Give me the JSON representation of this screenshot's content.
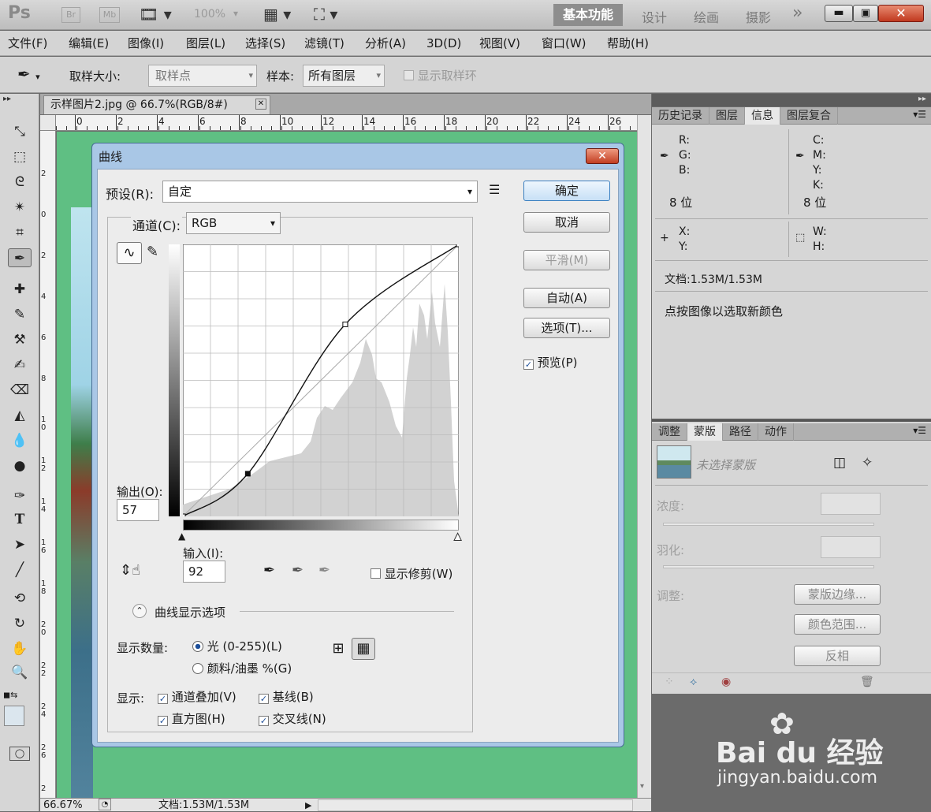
{
  "appbar": {
    "logo": "Ps",
    "br": "Br",
    "mb": "Mb",
    "zoom": "100%",
    "workspaces": [
      "基本功能",
      "设计",
      "绘画",
      "摄影"
    ],
    "more": "»"
  },
  "menubar": [
    "文件(F)",
    "编辑(E)",
    "图像(I)",
    "图层(L)",
    "选择(S)",
    "滤镜(T)",
    "分析(A)",
    "3D(D)",
    "视图(V)",
    "窗口(W)",
    "帮助(H)"
  ],
  "options": {
    "sample_size_label": "取样大小:",
    "sample_size_value": "取样点",
    "sample_label": "样本:",
    "sample_value": "所有图层",
    "show_ring": "显示取样环"
  },
  "document": {
    "tab_title": "示样图片2.jpg @ 66.7%(RGB/8#)",
    "zoom": "66.67%",
    "status": "文档:1.53M/1.53M",
    "ruler_h": [
      "0",
      "2",
      "4",
      "6",
      "8",
      "10",
      "12",
      "14",
      "16",
      "18",
      "20",
      "22",
      "24",
      "26"
    ],
    "ruler_v": [
      "2",
      "0",
      "2",
      "4",
      "6",
      "8",
      "10",
      "12",
      "14",
      "16",
      "18",
      "20",
      "22",
      "24",
      "26",
      "2"
    ]
  },
  "curves": {
    "title": "曲线",
    "preset_label": "预设(R):",
    "preset_value": "自定",
    "channel_label": "通道(C):",
    "channel_value": "RGB",
    "output_label": "输出(O):",
    "output_value": "57",
    "input_label": "输入(I):",
    "input_value": "92",
    "show_clipping": "显示修剪(W)",
    "display_options": "曲线显示选项",
    "amount_label": "显示数量:",
    "light": "光 (0-255)(L)",
    "pigment": "颜料/油墨 %(G)",
    "show_label": "显示:",
    "channel_overlays": "通道叠加(V)",
    "baseline": "基线(B)",
    "histogram": "直方图(H)",
    "intersection": "交叉线(N)",
    "buttons": {
      "ok": "确定",
      "cancel": "取消",
      "smooth": "平滑(M)",
      "auto": "自动(A)",
      "options": "选项(T)...",
      "preview": "预览(P)"
    },
    "points": [
      [
        0,
        0
      ],
      [
        60,
        40
      ],
      [
        150,
        180
      ],
      [
        255,
        255
      ]
    ]
  },
  "info_panel": {
    "tabs": [
      "历史记录",
      "图层",
      "信息",
      "图层复合"
    ],
    "active_tab": "信息",
    "r": "R:",
    "g": "G:",
    "b": "B:",
    "bits1": "8 位",
    "c": "C:",
    "m": "M:",
    "y": "Y:",
    "k": "K:",
    "bits2": "8 位",
    "x": "X:",
    "y2": "Y:",
    "w": "W:",
    "h": "H:",
    "doc": "文档:1.53M/1.53M",
    "hint": "点按图像以选取新颜色"
  },
  "mask_panel": {
    "tabs": [
      "调整",
      "蒙版",
      "路径",
      "动作"
    ],
    "active_tab": "蒙版",
    "no_mask": "未选择蒙版",
    "density": "浓度:",
    "feather": "羽化:",
    "adjust": "调整:",
    "mask_edge": "蒙版边缘...",
    "color_range": "颜色范围...",
    "invert": "反相"
  },
  "watermark": {
    "brand": "Bai du 经验",
    "url": "jingyan.baidu.com"
  }
}
